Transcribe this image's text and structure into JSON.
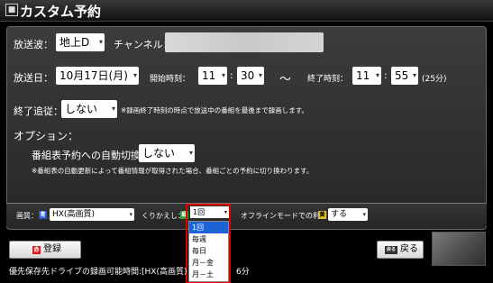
{
  "title": "カスタム予約",
  "title_icon": "■",
  "broadcast": {
    "label": "放送波：",
    "value": "地上D"
  },
  "channel": {
    "label": "チャンネル："
  },
  "date": {
    "label": "放送日：",
    "value": "10月17日(月)"
  },
  "start": {
    "label": "開始時刻：",
    "hour": "11",
    "minute": "30",
    "sep": ":"
  },
  "tilde": "～",
  "end": {
    "label": "終了時刻：",
    "hour": "11",
    "minute": "55",
    "duration": "(25分)",
    "sep": ":"
  },
  "follow": {
    "label": "終了追従：",
    "value": "しない",
    "note": "※録画終了時刻の時点で放送中の番組を最後まで録画します。"
  },
  "options": {
    "heading": "オプション：",
    "auto_switch_label": "番組表予約への自動切換：",
    "auto_switch_value": "しない",
    "auto_switch_note": "※番組表の自動更新によって番組情報が取得された場合、番組ごとの予約に切り換わります。"
  },
  "quality": {
    "label": "画質：",
    "badge": "青",
    "badge_color": "#2a58d8",
    "value": "HX(高画質)"
  },
  "repeat": {
    "label": "くりかえし：",
    "badge": "緑",
    "badge_color": "#2fa23a",
    "value": "1回",
    "options": [
      "1回",
      "毎週",
      "毎日",
      "月－金",
      "月－土"
    ],
    "selected_index": 0
  },
  "offline": {
    "label": "オフラインモードでの利用：",
    "badge": "黄",
    "badge_color": "#e0c020",
    "value": "する"
  },
  "buttons": {
    "register": {
      "label": "登録",
      "badge": "赤",
      "badge_color": "#d42020"
    },
    "back": {
      "label": "戻る",
      "badge": "戻る"
    }
  },
  "status_text": "優先保存先ドライブの録画可能時間:[HX(高画質)",
  "status_tail": "6分",
  "accent_red": "#e00000",
  "selection_blue": "#1e63d6"
}
